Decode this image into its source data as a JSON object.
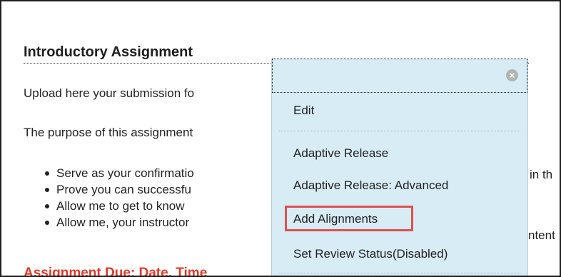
{
  "assignment": {
    "title": "Introductory Assignment",
    "upload_text": "Upload here your submission fo",
    "purpose_text": "The purpose of this assignment",
    "bullets": [
      "Serve as your confirmatio",
      "Prove you can successfu",
      "Allow me to get to know",
      "Allow me, your instructor"
    ],
    "due_text": "Assignment Due: Date, Time",
    "right_fragments": [
      "in th",
      "ntent"
    ]
  },
  "menu": {
    "close_icon": "close-circle-icon",
    "items": {
      "edit": "Edit",
      "adaptive_release": "Adaptive Release",
      "adaptive_release_advanced": "Adaptive Release: Advanced",
      "add_alignments": "Add Alignments",
      "set_review_status": "Set Review Status(Disabled)"
    },
    "highlighted_item": "Add Alignments"
  },
  "colors": {
    "menu_bg": "#d8ecf5",
    "highlight": "#e05050",
    "due_text": "#e03a2a"
  }
}
